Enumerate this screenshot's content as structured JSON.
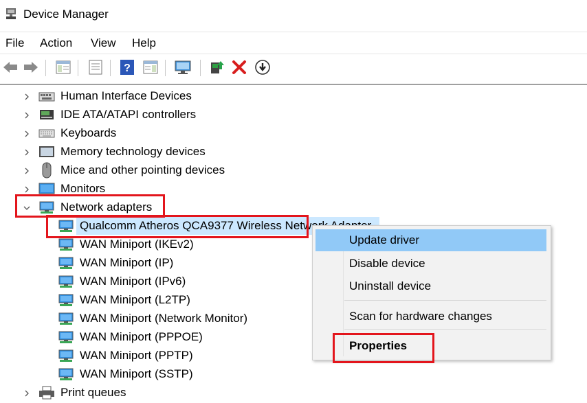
{
  "window": {
    "title": "Device Manager"
  },
  "menu": [
    "File",
    "Action",
    "View",
    "Help"
  ],
  "tree": {
    "categories_top": [
      {
        "label": "Human Interface Devices",
        "icon": "hid-icon"
      },
      {
        "label": "IDE ATA/ATAPI controllers",
        "icon": "ide-icon"
      },
      {
        "label": "Keyboards",
        "icon": "keyboard-icon"
      },
      {
        "label": "Memory technology devices",
        "icon": "memory-icon"
      },
      {
        "label": "Mice and other pointing devices",
        "icon": "mouse-icon"
      },
      {
        "label": "Monitors",
        "icon": "monitor-icon"
      }
    ],
    "expanded": {
      "label": "Network adapters",
      "icon": "network-icon",
      "children": [
        "Qualcomm Atheros QCA9377 Wireless Network Adapter",
        "WAN Miniport (IKEv2)",
        "WAN Miniport (IP)",
        "WAN Miniport (IPv6)",
        "WAN Miniport (L2TP)",
        "WAN Miniport (Network Monitor)",
        "WAN Miniport (PPPOE)",
        "WAN Miniport (PPTP)",
        "WAN Miniport (SSTP)"
      ]
    },
    "categories_bottom": [
      {
        "label": "Print queues",
        "icon": "printer-icon"
      }
    ]
  },
  "context_menu": {
    "update": "Update driver",
    "disable": "Disable device",
    "uninstall": "Uninstall device",
    "scan": "Scan for hardware changes",
    "properties": "Properties"
  },
  "colors": {
    "highlight_red": "#e3151c",
    "selection": "#cce8ff",
    "menu_hover": "#91c9f7"
  }
}
